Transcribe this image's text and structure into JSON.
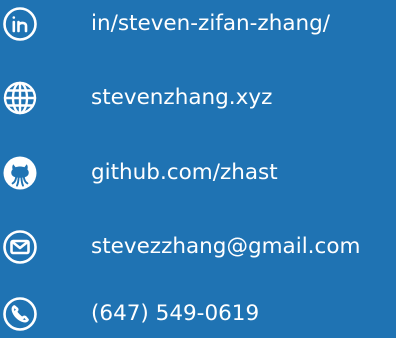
{
  "colors": {
    "background": "#1f73b3",
    "foreground": "#ffffff"
  },
  "contacts": [
    {
      "icon": "linkedin-icon",
      "label": "in/steven-zifan-zhang/"
    },
    {
      "icon": "globe-icon",
      "label": "stevenzhang.xyz"
    },
    {
      "icon": "github-icon",
      "label": "github.com/zhast"
    },
    {
      "icon": "email-icon",
      "label": "stevezzhang@gmail.com"
    },
    {
      "icon": "phone-icon",
      "label": "(647) 549-0619"
    }
  ]
}
